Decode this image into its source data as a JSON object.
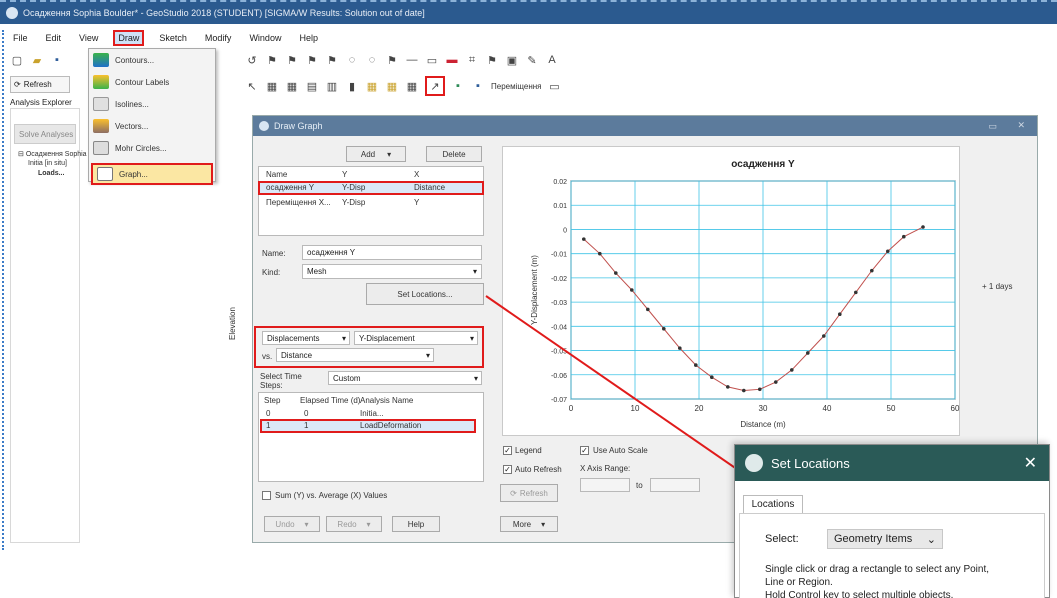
{
  "window": {
    "title": "Осадження Sophia Boulder* - GeoStudio 2018 (STUDENT) [SIGMA/W Results: Solution out of date]"
  },
  "menu": [
    "File",
    "Edit",
    "View",
    "Draw",
    "Sketch",
    "Modify",
    "Window",
    "Help"
  ],
  "toolbar": {
    "refresh_label": "Refresh",
    "explorer_title": "Analysis Explorer",
    "explorer_button": "Solve Analyses",
    "move_label": "Переміщення"
  },
  "tree": [
    "Осадження Sophia",
    "Initia [in situ]",
    "Loads..."
  ],
  "draw_menu": {
    "items": [
      "Contours...",
      "Contour Labels",
      "Isolines...",
      "Vectors...",
      "Mohr Circles...",
      "Graph..."
    ]
  },
  "draw_graph": {
    "title": "Draw Graph",
    "add_label": "Add",
    "delete_label": "Delete",
    "graph_list": {
      "headers": [
        "Name",
        "Y",
        "X"
      ],
      "rows": [
        [
          "осадження Y",
          "Y-Disp",
          "Distance"
        ],
        [
          "Переміщення Х...",
          "Y-Disp",
          "Y"
        ]
      ]
    },
    "name_label": "Name:",
    "name_value": "осадження Y",
    "kind_label": "Kind:",
    "kind_value": "Mesh",
    "set_locations_label": "Set Locations...",
    "y_category": "Displacements",
    "y_param": "Y-Displacement",
    "vs_label": "vs.",
    "x_param": "Distance",
    "side_label": "Elevation",
    "select_time_label": "Select Time Steps:",
    "time_mode": "Custom",
    "steps": {
      "headers": [
        "Step",
        "Elapsed Time (d)",
        "Analysis Name"
      ],
      "rows": [
        [
          "0",
          "0",
          "Initia..."
        ],
        [
          "1",
          "1",
          "LoadDeformation"
        ]
      ]
    },
    "sum_label": "Sum (Y) vs. Average (X) Values",
    "legend_label": "Legend",
    "auto_refresh_label": "Auto Refresh",
    "use_auto_scale_label": "Use Auto Scale",
    "x_axis_range_label": "X Axis Range:",
    "to_label": "to",
    "refresh_label": "Refresh",
    "undo_label": "Undo",
    "redo_label": "Redo",
    "help_label": "Help",
    "more_label": "More"
  },
  "chart_data": {
    "type": "line",
    "title": "осадження Y",
    "xlabel": "Distance (m)",
    "ylabel": "Y-Displacement (m)",
    "xlim": [
      0,
      60
    ],
    "ylim": [
      -0.07,
      0.02
    ],
    "xticks": [
      "0",
      "10",
      "20",
      "30",
      "40",
      "50",
      "60"
    ],
    "yticks": [
      "-0.07",
      "-0.06",
      "-0.05",
      "-0.04",
      "-0.03",
      "-0.02",
      "-0.01",
      "0",
      "0.01",
      "0.02"
    ],
    "grid": true,
    "legend_position": "right",
    "series": [
      {
        "name": "1 days",
        "color": "#c0504d",
        "x": [
          2,
          4.5,
          7,
          9.5,
          12,
          14.5,
          17,
          19.5,
          22,
          24.5,
          27,
          29.5,
          32,
          34.5,
          37,
          39.5,
          42,
          44.5,
          47,
          49.5,
          52,
          55
        ],
        "y": [
          -0.004,
          -0.01,
          -0.018,
          -0.025,
          -0.033,
          -0.041,
          -0.049,
          -0.056,
          -0.061,
          -0.065,
          -0.0665,
          -0.066,
          -0.063,
          -0.058,
          -0.051,
          -0.044,
          -0.035,
          -0.026,
          -0.017,
          -0.009,
          -0.003,
          0.001
        ]
      }
    ]
  },
  "set_locations": {
    "title": "Set Locations",
    "close": "✕",
    "tab_label": "Locations",
    "select_label": "Select:",
    "select_value": "Geometry Items",
    "hint_lines": [
      "Single click or drag a rectangle to select any Point,",
      "Line or Region.",
      "Hold Control key to select multiple objects."
    ]
  },
  "colors": {
    "titlebar": "#2b5a8f",
    "dialog_title": "#5c7b9c",
    "set_locations_title": "#2a5a57",
    "highlight": "#e01b1b",
    "plot_line": "#c0504d"
  }
}
